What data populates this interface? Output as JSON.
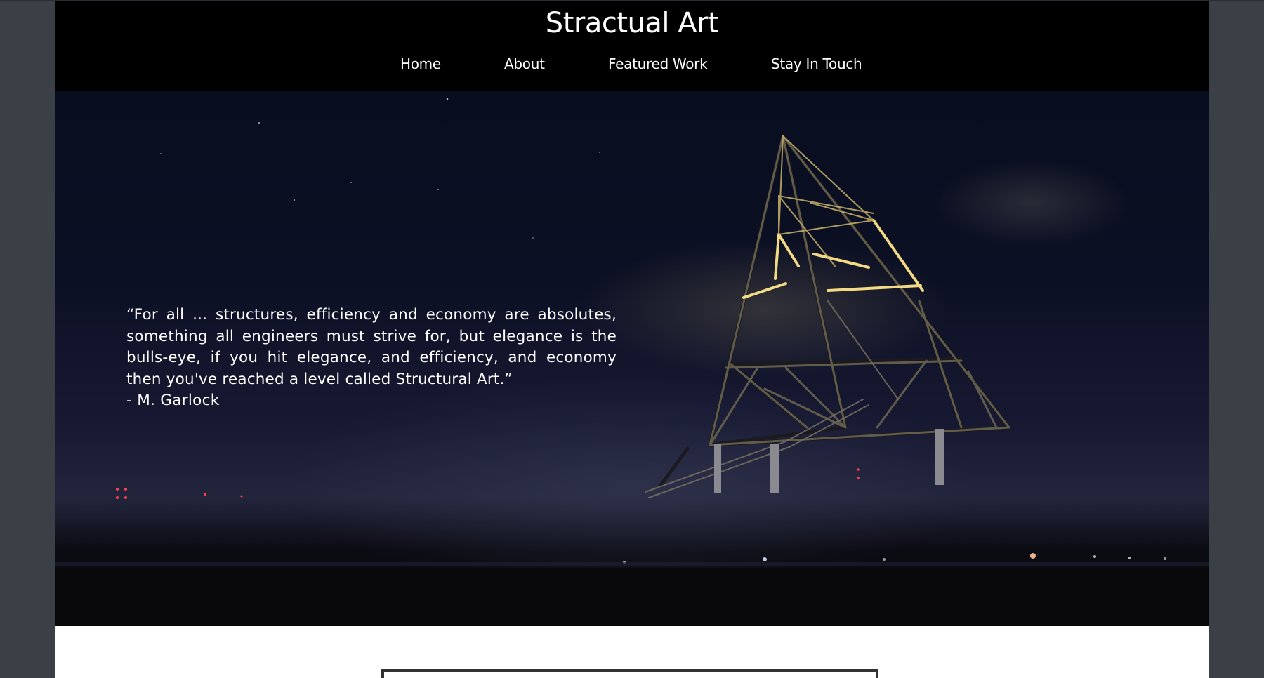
{
  "site": {
    "title": "Stractual Art"
  },
  "nav": {
    "items": [
      {
        "label": "Home"
      },
      {
        "label": "About"
      },
      {
        "label": "Featured Work"
      },
      {
        "label": "Stay In Touch"
      }
    ]
  },
  "hero": {
    "quote": "“For all ... structures, efficiency and economy are absolutes, something all engineers must strive for, but elegance is the bulls-eye, if you hit elegance, and efficiency, and economy then you've reached a level called Structural Art.”",
    "author": "- M. Garlock"
  },
  "colors": {
    "header_bg": "#000000",
    "outer_bg": "#3b4047",
    "page_bg": "#ffffff",
    "structure_light": "#f6dc7a"
  },
  "icons": [
    "tetrahedron-structure-image"
  ]
}
